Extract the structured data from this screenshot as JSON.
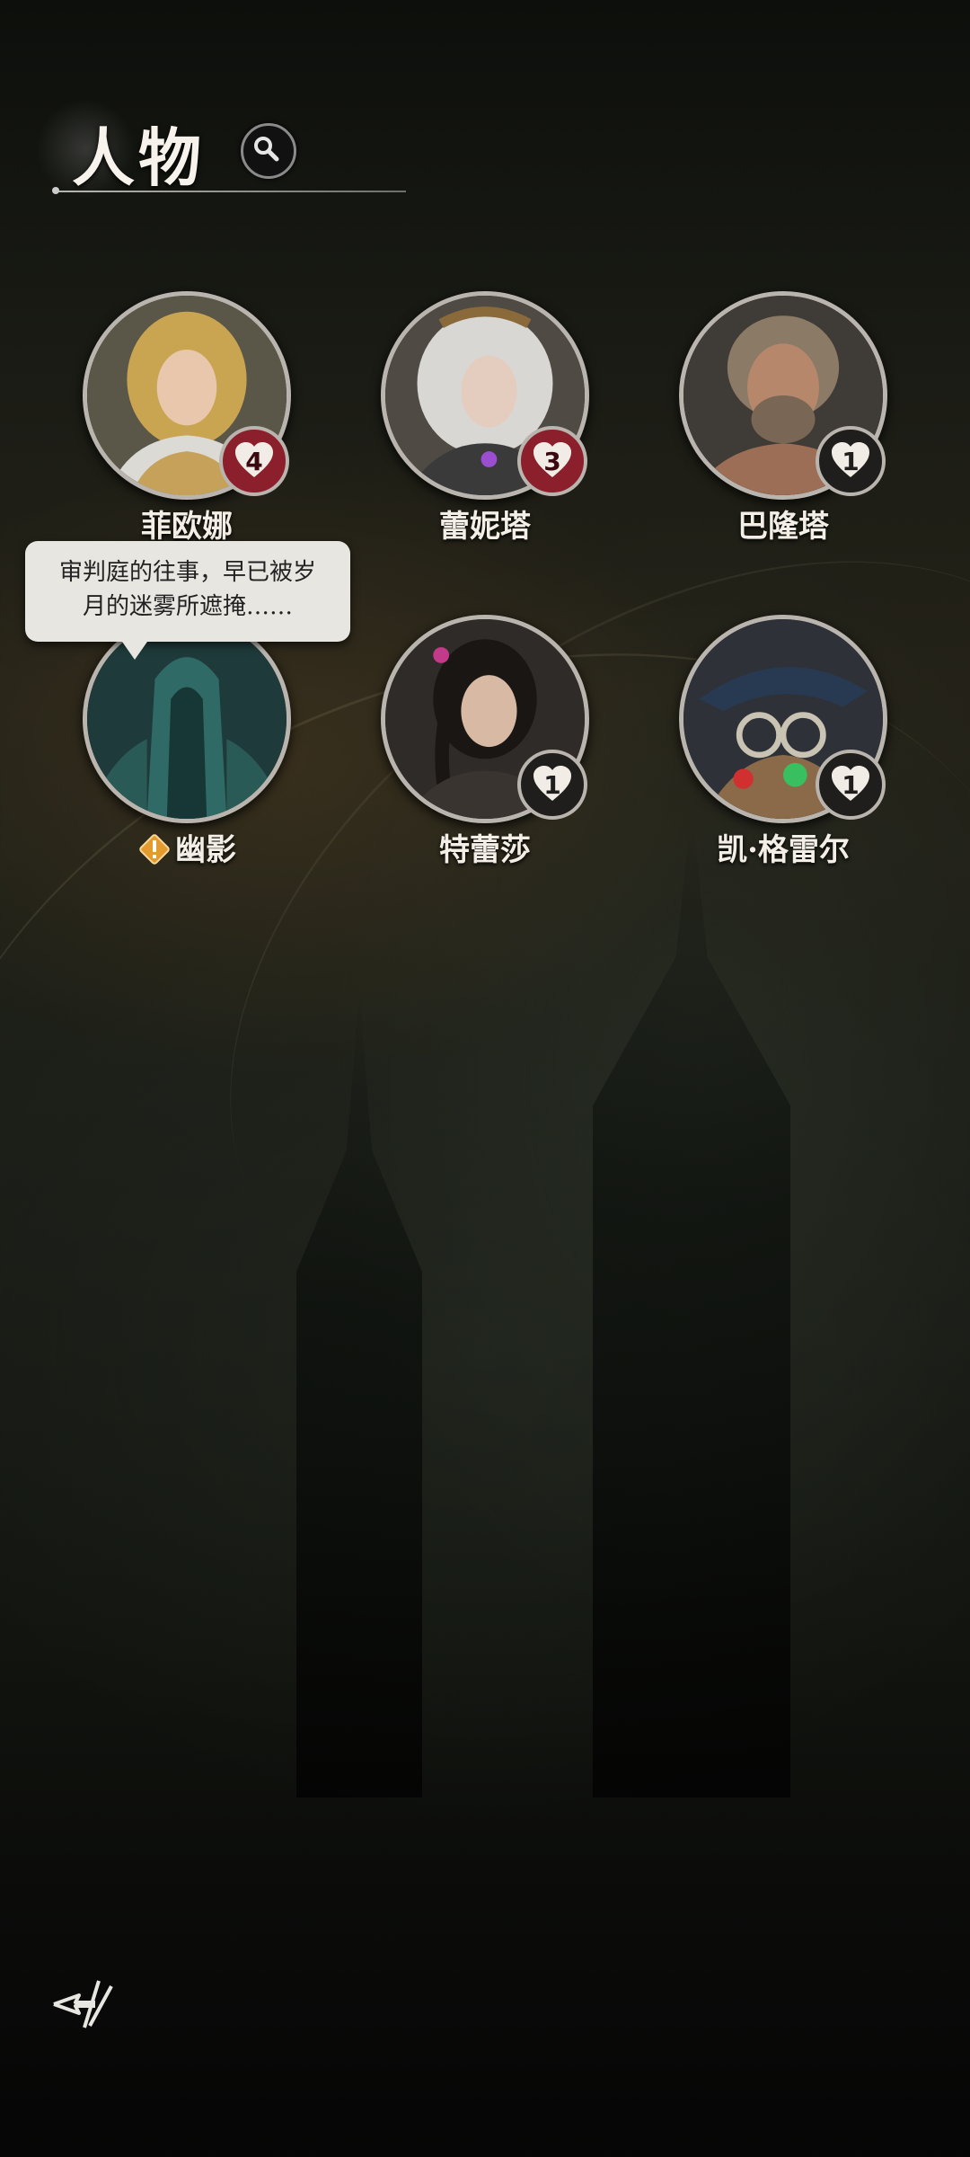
{
  "header": {
    "title": "人物"
  },
  "characters": [
    {
      "name": "菲欧娜",
      "affinity": "4",
      "badge_style": "red"
    },
    {
      "name": "蕾妮塔",
      "affinity": "3",
      "badge_style": "red"
    },
    {
      "name": "巴隆塔",
      "affinity": "1",
      "badge_style": "dark"
    },
    {
      "name": "幽影",
      "alert": true
    },
    {
      "name": "特蕾莎",
      "affinity": "1",
      "badge_style": "dark"
    },
    {
      "name": "凯·格雷尔",
      "affinity": "1",
      "badge_style": "dark"
    }
  ],
  "tooltip": {
    "line1": "审判庭的往事，早已被岁",
    "line2": "月的迷雾所遮掩……"
  },
  "colors": {
    "heart_red": "#8b1f2b",
    "badge_dark": "#1f1e1c",
    "alert_orange": "#e39a2f"
  }
}
